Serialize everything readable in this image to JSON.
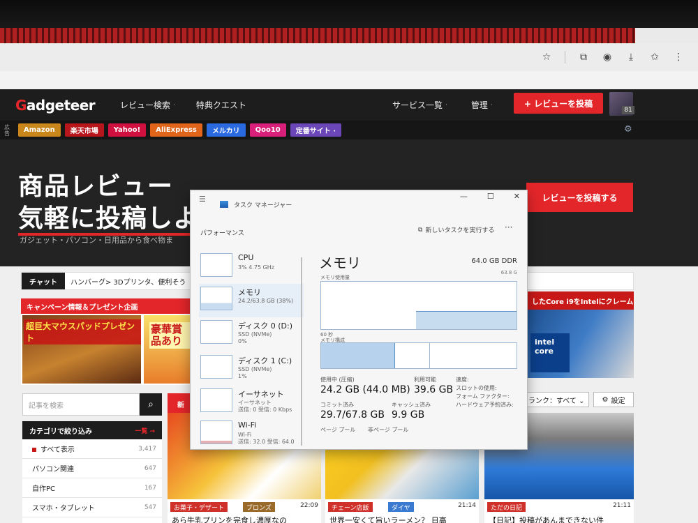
{
  "browser": {
    "toolbar_icons": [
      "star-icon",
      "extension-icon",
      "account-icon",
      "download-icon",
      "bookmark-icon",
      "menu-icon"
    ]
  },
  "header": {
    "logo": "adgeteer",
    "logo_initial": "G",
    "nav": [
      {
        "label": "レビュー検索",
        "chevron": "·"
      },
      {
        "label": "特典クエスト",
        "chevron": ""
      }
    ],
    "nav_right": [
      {
        "label": "サービス一覧",
        "chevron": "·"
      },
      {
        "label": "管理",
        "chevron": "·"
      }
    ],
    "post_button": "+ レビューを投稿",
    "avatar_badge": "81"
  },
  "ad_bar": {
    "label": "広告",
    "chips": [
      {
        "label": "Amazon",
        "color": "#c9861a"
      },
      {
        "label": "楽天市場",
        "color": "#b8161d"
      },
      {
        "label": "Yahoo!",
        "color": "#d0103e"
      },
      {
        "label": "AliExpress",
        "color": "#e0641a"
      },
      {
        "label": "メルカリ",
        "color": "#2a6ae0"
      },
      {
        "label": "Qoo10",
        "color": "#d81f7a"
      },
      {
        "label": "定番サイト ·",
        "color": "#6a46b8"
      }
    ]
  },
  "hero": {
    "title_line1": "商品レビュー",
    "title_line2": "気軽に投稿しよ",
    "subtitle": "ガジェット・パソコン・日用品から食べ物ま",
    "cta": "レビューを投稿する"
  },
  "chat": {
    "tag": "チャット",
    "text": "ハンバーグ> 3Dプリンタ、便利そう"
  },
  "campaign": {
    "heading": "キャンペーン情報＆プレゼント企画",
    "banner1": "超巨大マウスパッドプレゼント",
    "banner2": "豪華賞品あり"
  },
  "right_card": {
    "heading": "したCore i9をIntelにクレーム",
    "box_text": "intel core"
  },
  "sidebar": {
    "search_placeholder": "記事を検索",
    "category_heading": "カテゴリで絞り込み",
    "category_all_link": "一覧 →",
    "categories": [
      {
        "label": "すべて表示",
        "count": "3,417"
      },
      {
        "label": "パソコン関連",
        "count": "647"
      },
      {
        "label": "自作PC",
        "count": "167"
      },
      {
        "label": "スマホ・タブレット",
        "count": "547"
      }
    ]
  },
  "feed": {
    "new_tab": "新",
    "rank_filter": "ランク：すべて ⌄",
    "settings": "設定",
    "cards": [
      {
        "tag": "お菓子・デザート",
        "tag_color": "#d0302a",
        "tag2": "ブロンズ",
        "tag2_color": "#9a6a2a",
        "time": "22:09",
        "title": "あら牛乳プリンを完食し濃厚なの"
      },
      {
        "tag": "チェーン店飯",
        "tag_color": "#d0302a",
        "tag2": "ダイヤ",
        "tag2_color": "#3a7ad0",
        "time": "21:14",
        "title": "世界一安くて旨いラーメン？ 日高"
      },
      {
        "tag": "ただの日記",
        "tag_color": "#d0302a",
        "tag2": "",
        "tag2_color": "#ffffff",
        "time": "21:11",
        "title": "【日記】投稿があんまできない件"
      }
    ]
  },
  "task_manager": {
    "title": "タスク マネージャー",
    "section": "パフォーマンス",
    "run_task": "新しいタスクを実行する",
    "more": "···",
    "win_buttons": [
      "—",
      "☐",
      "✕"
    ],
    "items": [
      {
        "name": "CPU",
        "sub": "3%  4.75 GHz"
      },
      {
        "name": "メモリ",
        "sub": "24.2/63.8 GB (38%)"
      },
      {
        "name": "ディスク 0 (D:)",
        "sub": "SSD (NVMe)\n0%"
      },
      {
        "name": "ディスク 1 (C:)",
        "sub": "SSD (NVMe)\n1%"
      },
      {
        "name": "イーサネット",
        "sub": "イーサネット\n送信: 0 受信: 0 Kbps"
      },
      {
        "name": "Wi-Fi",
        "sub": "Wi-Fi\n送信: 32.0 受信: 64.0"
      }
    ],
    "memory": {
      "heading": "メモリ",
      "capacity": "64.0 GB DDR",
      "capacity_sub": "63.8 G",
      "usage_label": "メモリ使用量",
      "time_label": "60 秒",
      "composition_label": "メモリ構成",
      "in_use_label": "使用中 (圧縮)",
      "in_use_value": "24.2 GB (44.0 MB)",
      "available_label": "利用可能",
      "available_value": "39.6 GB",
      "committed_label": "コミット済み",
      "committed_value": "29.7/67.8 GB",
      "cached_label": "キャッシュ済み",
      "cached_value": "9.9 GB",
      "speed_label": "速度:",
      "slots_label": "スロットの使用:",
      "form_factor_label": "フォーム ファクター:",
      "hw_reserved_label": "ハードウェア予約済み:",
      "paged_label": "ページ プール",
      "nonpaged_label": "非ページ プール",
      "usage_fraction": 0.38
    }
  }
}
